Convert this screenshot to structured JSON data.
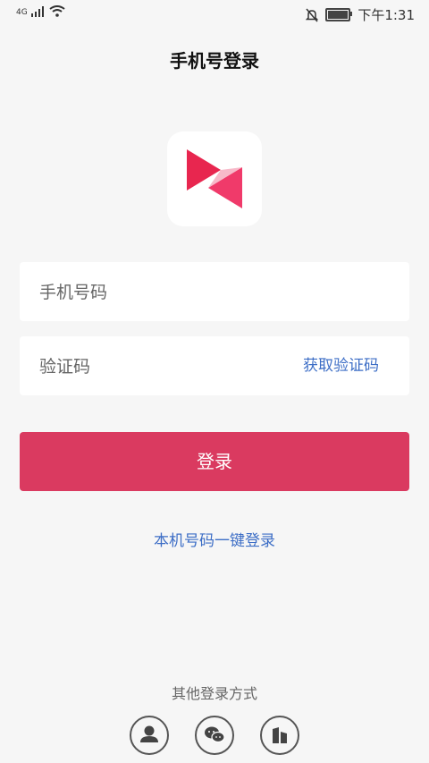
{
  "status_bar": {
    "network": "4G",
    "time": "下午1:31",
    "icons": [
      "signal-icon",
      "wifi-icon",
      "mute-bell-icon",
      "battery-icon"
    ]
  },
  "header": {
    "title": "手机号登录"
  },
  "logo": {
    "icon": "app-logo-icon",
    "colors": [
      "#e8264f",
      "#f03a6a"
    ]
  },
  "form": {
    "phone_placeholder": "手机号码",
    "code_placeholder": "验证码",
    "get_code_label": "获取验证码",
    "login_label": "登录"
  },
  "one_tap_login_label": "本机号码一键登录",
  "other_login": {
    "label": "其他登录方式",
    "methods": [
      {
        "icon": "user-icon"
      },
      {
        "icon": "wechat-icon"
      },
      {
        "icon": "building-icon"
      }
    ]
  },
  "colors": {
    "accent": "#da3a60",
    "link": "#3d6ec6",
    "background": "#f6f6f6"
  }
}
